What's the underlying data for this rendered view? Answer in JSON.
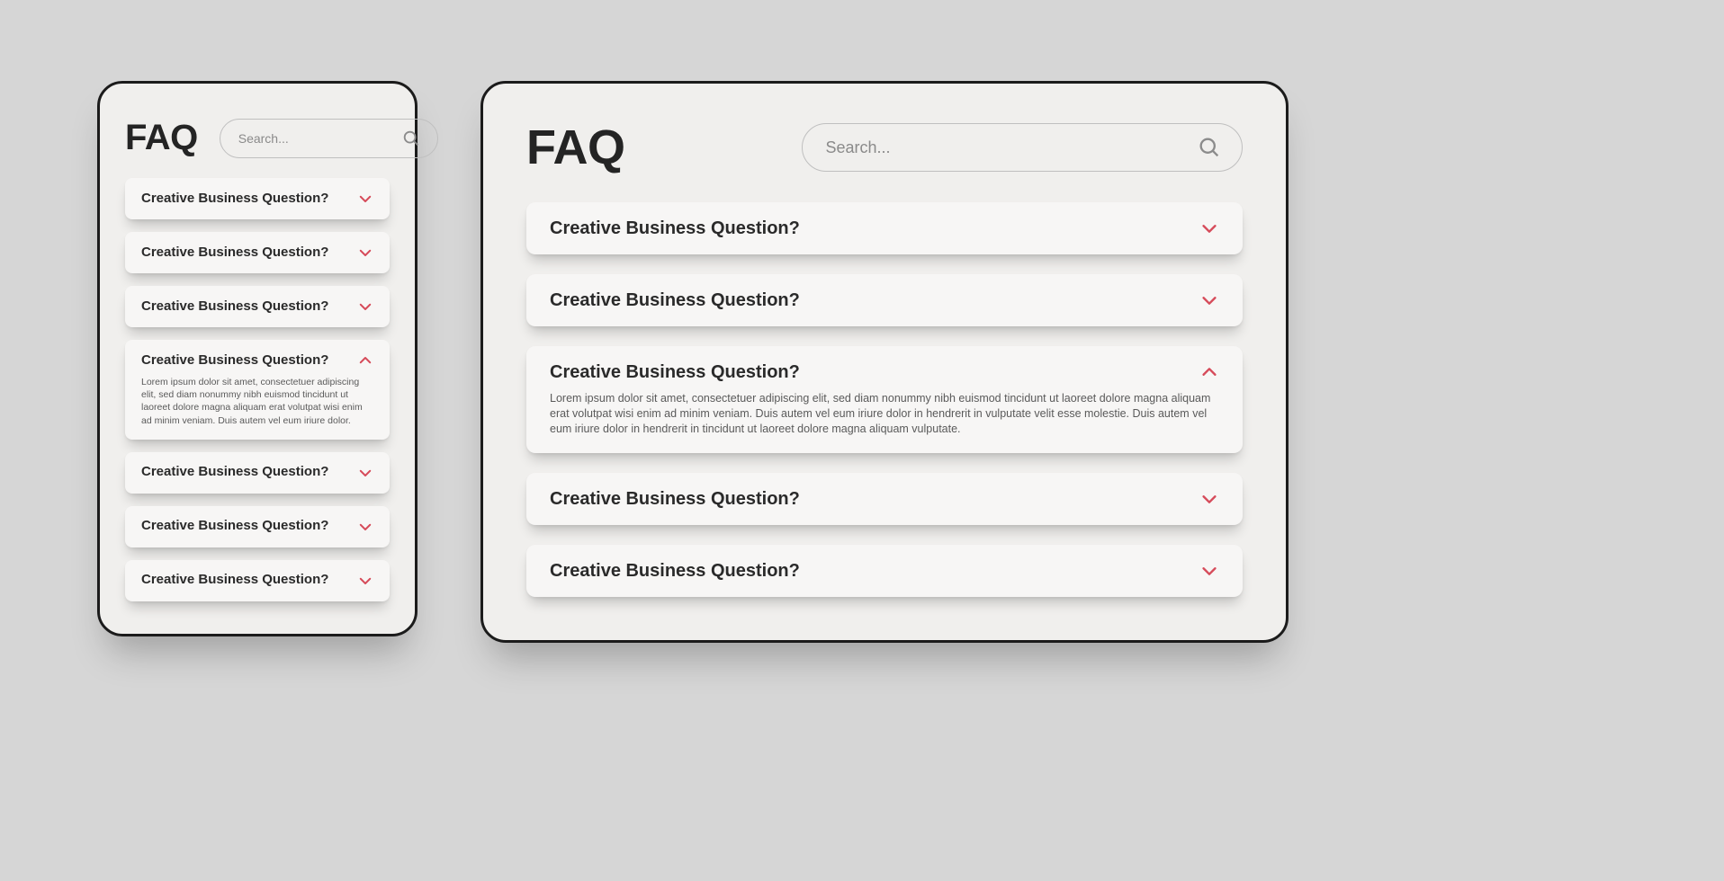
{
  "colors": {
    "accent": "#d64b5a",
    "text": "#242424",
    "panel_bg": "#f0efed",
    "card_bg": "#f7f6f5"
  },
  "shared": {
    "faq_heading": "FAQ",
    "search_placeholder": "Search...",
    "question_text": "Creative Business Question?"
  },
  "mobile": {
    "items": [
      {
        "expanded": false
      },
      {
        "expanded": false
      },
      {
        "expanded": false
      },
      {
        "expanded": true,
        "answer": "Lorem ipsum dolor sit amet, consectetuer adipiscing elit, sed diam nonummy nibh euismod tincidunt ut laoreet dolore magna aliquam erat volutpat wisi enim ad minim veniam. Duis autem vel eum iriure dolor."
      },
      {
        "expanded": false
      },
      {
        "expanded": false
      },
      {
        "expanded": false
      }
    ]
  },
  "desktop": {
    "items": [
      {
        "expanded": false
      },
      {
        "expanded": false
      },
      {
        "expanded": true,
        "answer": "Lorem ipsum dolor sit amet, consectetuer adipiscing elit, sed diam nonummy nibh euismod tincidunt ut laoreet dolore magna aliquam erat volutpat wisi enim ad minim veniam. Duis autem vel eum iriure dolor in hendrerit in vulputate velit esse molestie. Duis autem vel eum iriure dolor in hendrerit in tincidunt ut laoreet dolore magna aliquam vulputate."
      },
      {
        "expanded": false
      },
      {
        "expanded": false
      }
    ]
  }
}
